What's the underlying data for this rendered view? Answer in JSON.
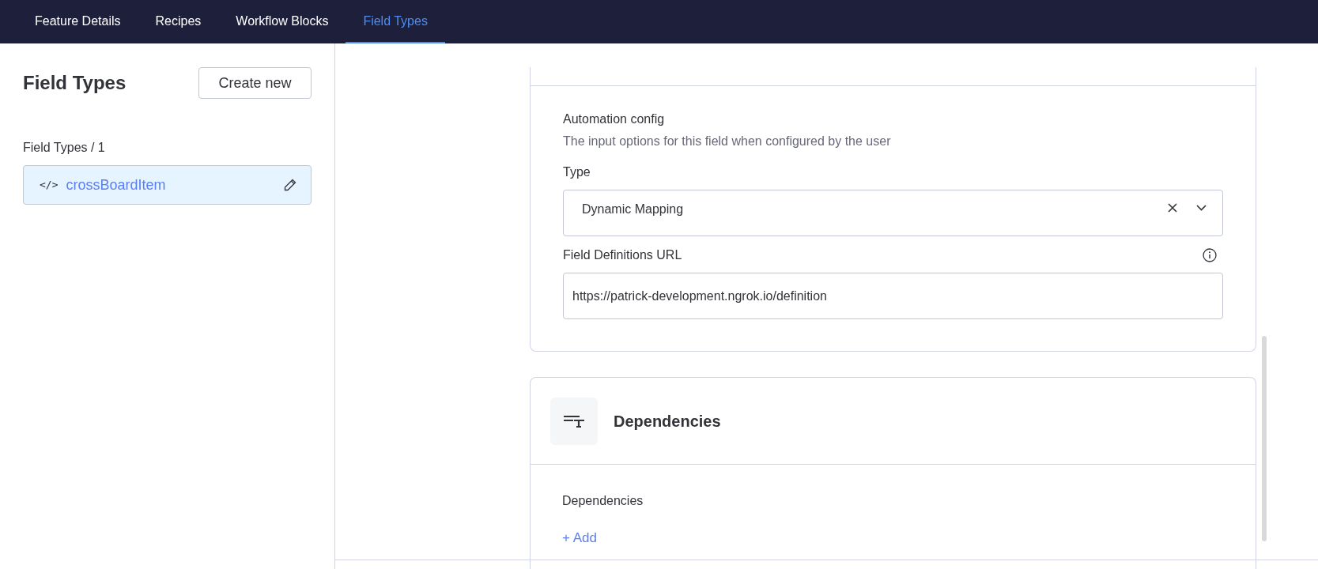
{
  "tabs": [
    {
      "label": "Feature Details",
      "selected": false
    },
    {
      "label": "Recipes",
      "selected": false
    },
    {
      "label": "Workflow Blocks",
      "selected": false
    },
    {
      "label": "Field Types",
      "selected": true
    }
  ],
  "sidebar": {
    "title": "Field Types",
    "create_button": "Create new",
    "breadcrumb": "Field Types / 1",
    "items": [
      {
        "label": "crossBoardItem",
        "icon": "</>",
        "selected": true
      }
    ]
  },
  "automation_config": {
    "title": "Automation config",
    "description": "The input options for this field when configured by the user",
    "type_label": "Type",
    "type_value": "Dynamic Mapping",
    "url_label": "Field Definitions URL",
    "url_value": "https://patrick-development.ngrok.io/definition"
  },
  "dependencies": {
    "title": "Dependencies",
    "label": "Dependencies",
    "add_link": "+ Add"
  }
}
